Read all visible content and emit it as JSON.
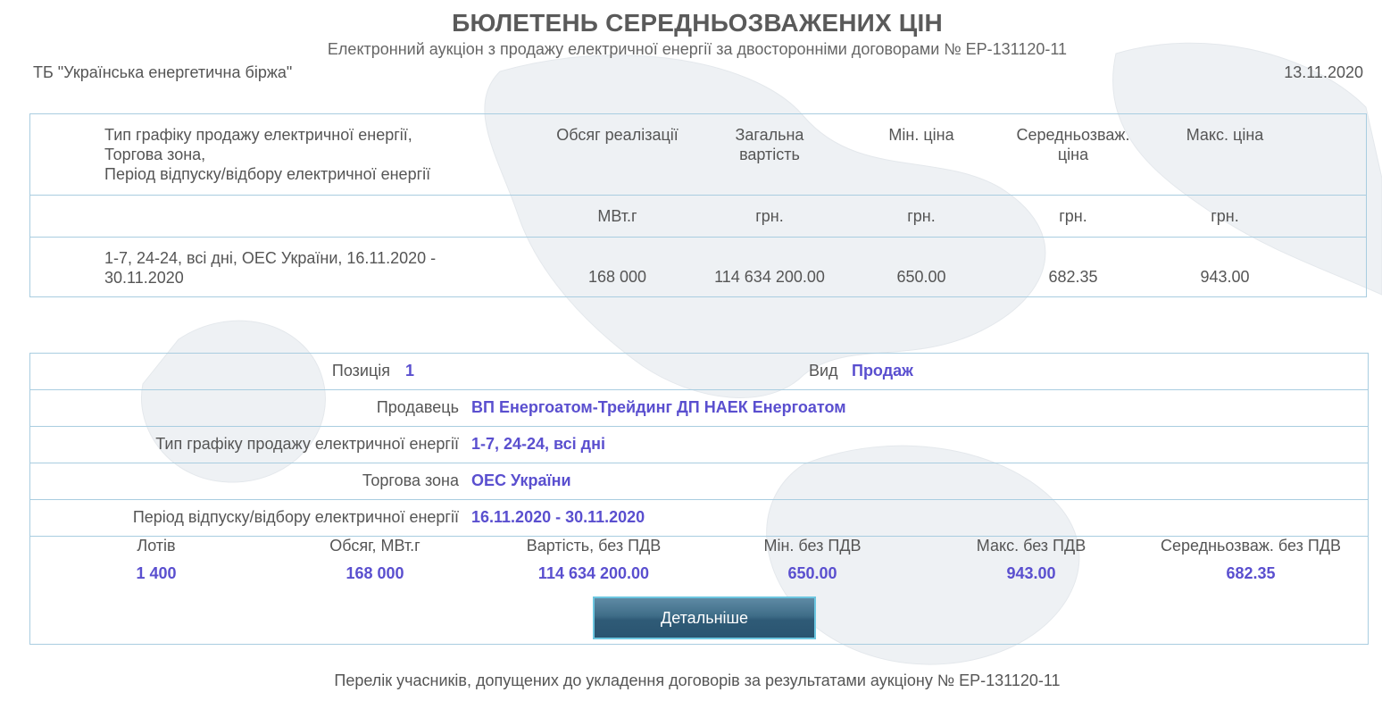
{
  "header": {
    "title": "БЮЛЕТЕНЬ СЕРЕДНЬОЗВАЖЕНИХ ЦІН",
    "subtitle": "Електронний аукціон з продажу електричної енергії за двосторонніми договорами № ЕР-131120-11",
    "exchange": "ТБ \"Українська енергетична біржа\"",
    "date": "13.11.2020"
  },
  "summary": {
    "headers": {
      "c0_line1": "Тип графіку продажу електричної енергії,",
      "c0_line2": "Торгова зона,",
      "c0_line3": "Період відпуску/відбору електричної енергії",
      "c1": "Обсяг реалізації",
      "c2_line1": "Загальна",
      "c2_line2": "вартість",
      "c3": "Мін. ціна",
      "c4_line1": "Середньозваж.",
      "c4_line2": "ціна",
      "c5": "Макс. ціна"
    },
    "units": {
      "c1": "МВт.г",
      "c2": "грн.",
      "c3": "грн.",
      "c4": "грн.",
      "c5": "грн."
    },
    "row": {
      "desc_line1": "1-7, 24-24, всі дні, ОЕС України, 16.11.2020 -",
      "desc_line2": "30.11.2020",
      "volume": "168 000",
      "total": "114 634 200.00",
      "min": "650.00",
      "avg": "682.35",
      "max": "943.00"
    }
  },
  "details": {
    "position_label": "Позиція",
    "position_value": "1",
    "kind_label": "Вид",
    "kind_value": "Продаж",
    "seller_label": "Продавець",
    "seller_value": "ВП Енергоатом-Трейдинг ДП НАЕК Енергоатом",
    "schedule_label": "Тип графіку продажу електричної енергії",
    "schedule_value": "1-7, 24-24, всі дні",
    "zone_label": "Торгова зона",
    "zone_value": "ОЕС України",
    "period_label": "Період відпуску/відбору електричної енергії",
    "period_value": "16.11.2020 - 30.11.2020",
    "stats": [
      {
        "label": "Лотів",
        "value": "1 400"
      },
      {
        "label": "Обсяг, МВт.г",
        "value": "168 000"
      },
      {
        "label": "Вартість, без ПДВ",
        "value": "114 634 200.00"
      },
      {
        "label": "Мін. без ПДВ",
        "value": "650.00"
      },
      {
        "label": "Макс. без ПДВ",
        "value": "943.00"
      },
      {
        "label": "Середньозваж. без ПДВ",
        "value": "682.35"
      }
    ],
    "button_label": "Детальніше"
  },
  "footer": {
    "text": "Перелік учасників, допущених до укладення договорів за результатами аукціону № ЕР-131120-11"
  },
  "colors": {
    "accent": "#5a4fcf",
    "border": "#a9cde0",
    "button": "#3f6d88"
  }
}
